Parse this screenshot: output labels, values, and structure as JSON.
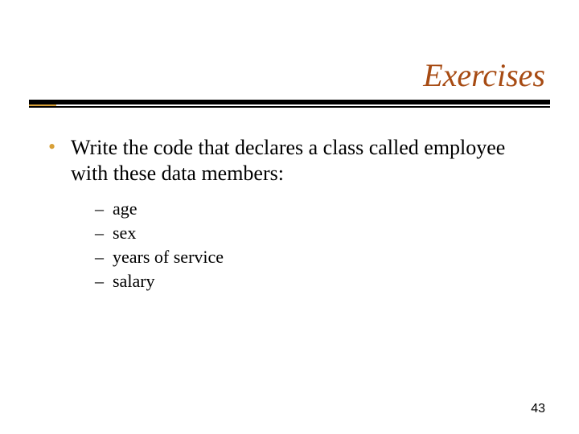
{
  "title": "Exercises",
  "bullet": {
    "text": "Write the code that declares a class called employee with these data members:"
  },
  "subitems": [
    {
      "label": "age"
    },
    {
      "label": "sex"
    },
    {
      "label": "years of service"
    },
    {
      "label": "salary"
    }
  ],
  "page_number": "43",
  "colors": {
    "accent": "#d8a038",
    "title": "#a74b13"
  }
}
